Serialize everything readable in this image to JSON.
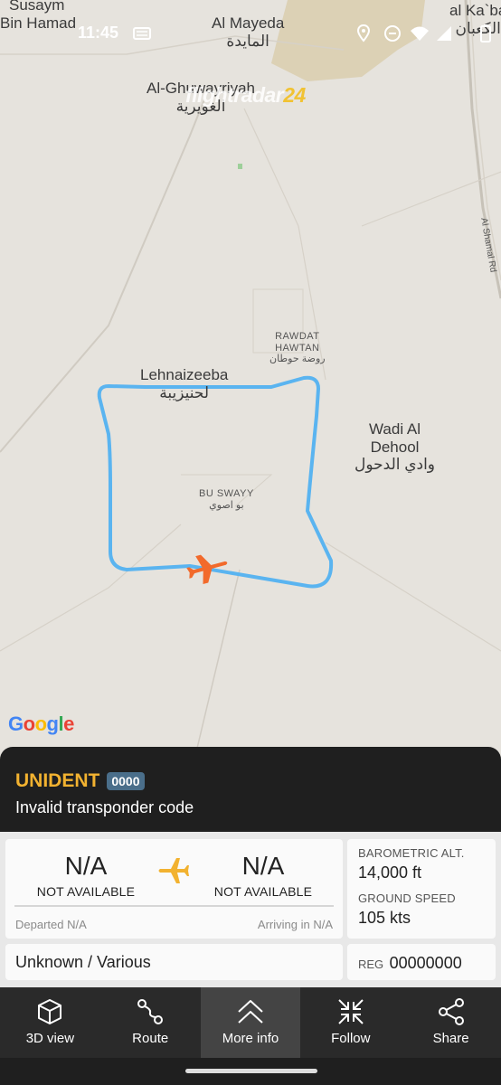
{
  "status_bar": {
    "time": "11:45"
  },
  "map": {
    "brand_name": "flightradar",
    "brand_number": "24",
    "provider": "Google",
    "labels": {
      "susaym": "Susaym",
      "bin_hamad": "Bin Hamad",
      "al_mayeda_en": "Al Mayeda",
      "al_mayeda_ar": "المايدة",
      "al_kaba_en": "al Ka`ba",
      "al_kaba_ar": "الكعبان",
      "ghuwayriyah_en": "Al-Ghuwayriyah",
      "ghuwayriyah_ar": "الغويرية",
      "shamal_rd": "Al Shamal Rd",
      "rawdat_1": "RAWDAT",
      "rawdat_2": "HAWTAN",
      "rawdat_ar": "روضة حوطان",
      "lehnaizeeba_en": "Lehnaizeeba",
      "lehnaizeeba_ar": "لحنيزيبة",
      "wadi_1": "Wadi Al",
      "wadi_2": "Dehool",
      "wadi_ar": "وادي الدحول",
      "buswayy_en": "BU SWAYY",
      "buswayy_ar": "بو اصوي"
    }
  },
  "flight": {
    "callsign": "UNIDENT",
    "squawk": "0000",
    "subtitle": "Invalid transponder code"
  },
  "route": {
    "origin_code": "N/A",
    "origin_name": "NOT AVAILABLE",
    "destination_code": "N/A",
    "destination_name": "NOT AVAILABLE",
    "departed": "Departed N/A",
    "arriving": "Arriving in N/A"
  },
  "stats": {
    "alt_label": "BAROMETRIC ALT.",
    "alt_value": "14,000 ft",
    "speed_label": "GROUND SPEED",
    "speed_value": "105 kts"
  },
  "aircraft": {
    "type": "Unknown / Various"
  },
  "registration": {
    "label": "REG",
    "value": "00000000"
  },
  "actions": [
    {
      "label": "3D view",
      "icon": "cube-icon"
    },
    {
      "label": "Route",
      "icon": "route-icon"
    },
    {
      "label": "More info",
      "icon": "chevron-up-icon"
    },
    {
      "label": "Follow",
      "icon": "follow-icon"
    },
    {
      "label": "Share",
      "icon": "share-icon"
    }
  ],
  "colors": {
    "accent": "#f2b230",
    "track": "#5ab4f0",
    "aircraft": "#f26a2b",
    "squawk_badge": "#4a6e8a"
  }
}
